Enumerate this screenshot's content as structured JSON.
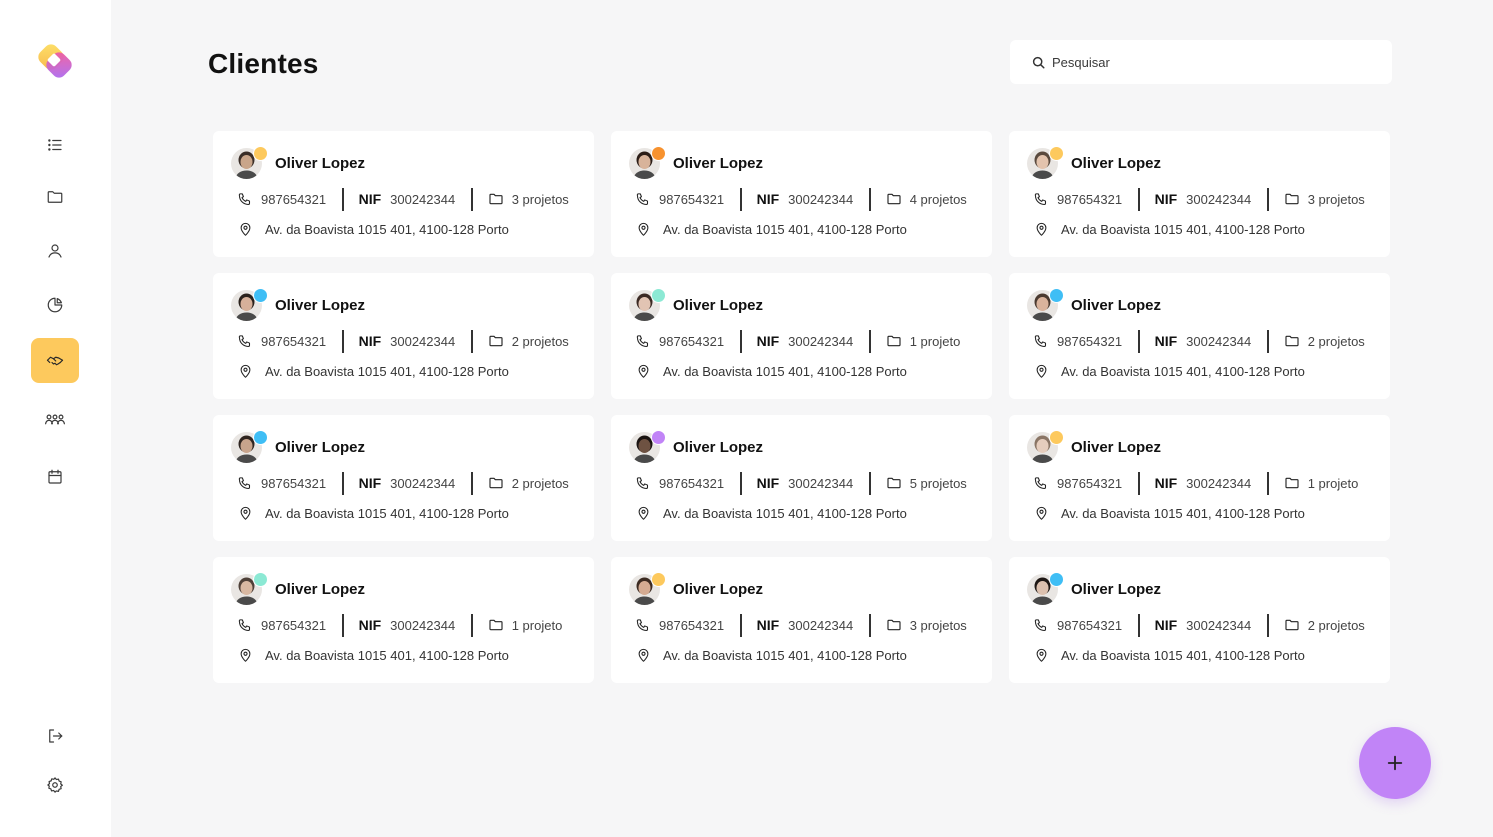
{
  "page": {
    "title": "Clientes",
    "search_placeholder": "Pesquisar"
  },
  "sidebar": {
    "items": [
      {
        "icon": "list-icon",
        "active": false
      },
      {
        "icon": "folder-icon",
        "active": false
      },
      {
        "icon": "user-icon",
        "active": false
      },
      {
        "icon": "pie-chart-icon",
        "active": false
      },
      {
        "icon": "handshake-icon",
        "active": true
      },
      {
        "icon": "users-group-icon",
        "active": false
      },
      {
        "icon": "calendar-icon",
        "active": false
      }
    ],
    "bottom": [
      {
        "icon": "logout-icon"
      },
      {
        "icon": "gear-icon"
      }
    ],
    "active_color": "#fdc95d"
  },
  "labels": {
    "nif": "NIF"
  },
  "clients": [
    {
      "name": "Oliver Lopez",
      "phone": "987654321",
      "nif": "300242344",
      "projects": "3 projetos",
      "address": "Av. da Boavista 1015 401, 4100-128 Porto",
      "dot_color": "#fdc95d",
      "skin": "#c9a58a",
      "hair": "#3a2e28"
    },
    {
      "name": "Oliver Lopez",
      "phone": "987654321",
      "nif": "300242344",
      "projects": "4 projetos",
      "address": "Av. da Boavista 1015 401, 4100-128 Porto",
      "dot_color": "#f7922f",
      "skin": "#d8b39a",
      "hair": "#2b1d17"
    },
    {
      "name": "Oliver Lopez",
      "phone": "987654321",
      "nif": "300242344",
      "projects": "3 projetos",
      "address": "Av. da Boavista 1015 401, 4100-128 Porto",
      "dot_color": "#fdc95d",
      "skin": "#e3c3ad",
      "hair": "#5a4a3e"
    },
    {
      "name": "Oliver Lopez",
      "phone": "987654321",
      "nif": "300242344",
      "projects": "2 projetos",
      "address": "Av. da Boavista 1015 401, 4100-128 Porto",
      "dot_color": "#3fbef5",
      "skin": "#d6b09a",
      "hair": "#2a211c"
    },
    {
      "name": "Oliver Lopez",
      "phone": "987654321",
      "nif": "300242344",
      "projects": "1 projeto",
      "address": "Av. da Boavista 1015 401, 4100-128 Porto",
      "dot_color": "#8ce9d4",
      "skin": "#e2c4b3",
      "hair": "#3b2a24"
    },
    {
      "name": "Oliver Lopez",
      "phone": "987654321",
      "nif": "300242344",
      "projects": "2 projetos",
      "address": "Av. da Boavista 1015 401, 4100-128 Porto",
      "dot_color": "#3fbef5",
      "skin": "#d9b39c",
      "hair": "#4a3a30"
    },
    {
      "name": "Oliver Lopez",
      "phone": "987654321",
      "nif": "300242344",
      "projects": "2 projetos",
      "address": "Av. da Boavista 1015 401, 4100-128 Porto",
      "dot_color": "#3fbef5",
      "skin": "#c8a48c",
      "hair": "#2f2520"
    },
    {
      "name": "Oliver Lopez",
      "phone": "987654321",
      "nif": "300242344",
      "projects": "5 projetos",
      "address": "Av. da Boavista 1015 401, 4100-128 Porto",
      "dot_color": "#c184f7",
      "skin": "#6e5242",
      "hair": "#1a1412"
    },
    {
      "name": "Oliver Lopez",
      "phone": "987654321",
      "nif": "300242344",
      "projects": "1 projeto",
      "address": "Av. da Boavista 1015 401, 4100-128 Porto",
      "dot_color": "#fdc95d",
      "skin": "#e6cdbd",
      "hair": "#8a7565"
    },
    {
      "name": "Oliver Lopez",
      "phone": "987654321",
      "nif": "300242344",
      "projects": "1 projeto",
      "address": "Av. da Boavista 1015 401, 4100-128 Porto",
      "dot_color": "#8ce9d4",
      "skin": "#d8b8a2",
      "hair": "#4e4038"
    },
    {
      "name": "Oliver Lopez",
      "phone": "987654321",
      "nif": "300242344",
      "projects": "3 projetos",
      "address": "Av. da Boavista 1015 401, 4100-128 Porto",
      "dot_color": "#fdc95d",
      "skin": "#d5ab92",
      "hair": "#3d2b22"
    },
    {
      "name": "Oliver Lopez",
      "phone": "987654321",
      "nif": "300242344",
      "projects": "2 projetos",
      "address": "Av. da Boavista 1015 401, 4100-128 Porto",
      "dot_color": "#3fbef5",
      "skin": "#dcc0ae",
      "hair": "#1f1815"
    }
  ],
  "fab": {
    "icon": "plus-icon",
    "color": "#c184f7"
  }
}
